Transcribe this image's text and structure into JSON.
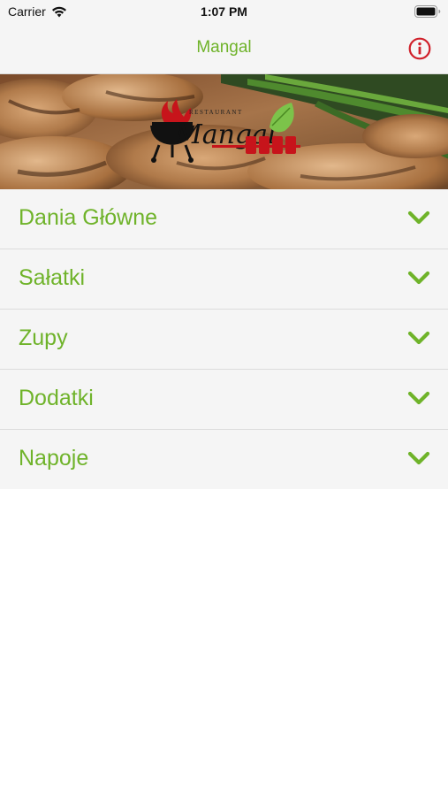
{
  "status_bar": {
    "carrier": "Carrier",
    "time": "1:07 PM"
  },
  "nav": {
    "title": "Mangal",
    "info_icon": "info-icon"
  },
  "hero": {
    "logo_script": "Mangal",
    "logo_small": "RESTAURANT"
  },
  "menu": {
    "items": [
      {
        "label": "Dania Główne",
        "icon": "chevron-down-icon"
      },
      {
        "label": "Sałatki",
        "icon": "chevron-down-icon"
      },
      {
        "label": "Zupy",
        "icon": "chevron-down-icon"
      },
      {
        "label": "Dodatki",
        "icon": "chevron-down-icon"
      },
      {
        "label": "Napoje",
        "icon": "chevron-down-icon"
      }
    ]
  },
  "colors": {
    "accent_green": "#6fb32a",
    "info_red": "#d0202a",
    "bar_background": "#f5f5f5"
  }
}
